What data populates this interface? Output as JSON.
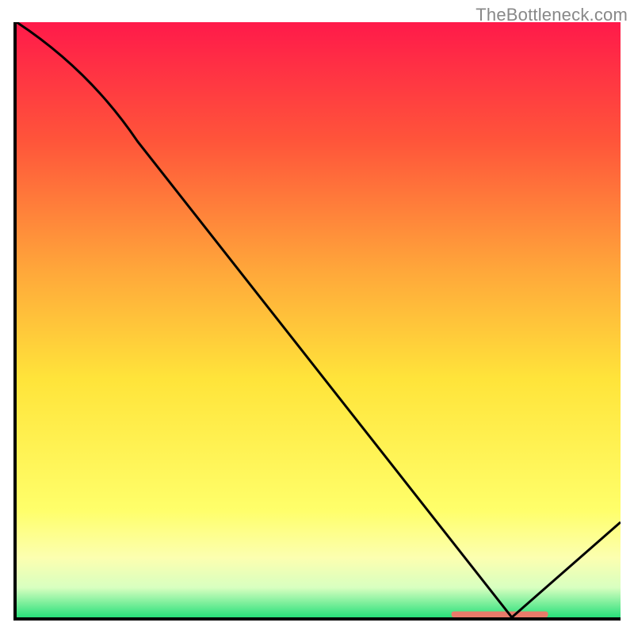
{
  "attribution": "TheBottleneck.com",
  "chart_data": {
    "type": "line",
    "title": "",
    "xlabel": "",
    "ylabel": "",
    "xlim": [
      0,
      100
    ],
    "ylim": [
      0,
      100
    ],
    "series": [
      {
        "name": "black-curve",
        "points": [
          {
            "x": 0,
            "y": 100
          },
          {
            "x": 20,
            "y": 80
          },
          {
            "x": 82,
            "y": 0
          },
          {
            "x": 100,
            "y": 16
          }
        ]
      }
    ],
    "background_gradient": {
      "type": "vertical",
      "stops": [
        {
          "pos": 0.0,
          "color": "#ff1a4a"
        },
        {
          "pos": 0.2,
          "color": "#ff553a"
        },
        {
          "pos": 0.42,
          "color": "#ffa83a"
        },
        {
          "pos": 0.6,
          "color": "#ffe43a"
        },
        {
          "pos": 0.82,
          "color": "#ffff6a"
        },
        {
          "pos": 0.9,
          "color": "#fcffb0"
        },
        {
          "pos": 0.95,
          "color": "#d8ffc0"
        },
        {
          "pos": 1.0,
          "color": "#28e07a"
        }
      ]
    },
    "marker": {
      "name": "optimum-bar",
      "color": "#e97a6a",
      "x0": 72,
      "x1": 88,
      "y": 0.5,
      "height": 1.0
    },
    "axes": {
      "show_ticks": false,
      "border": {
        "top": false,
        "right": false,
        "bottom": true,
        "left": true,
        "color": "#000000",
        "width": 4
      }
    }
  }
}
